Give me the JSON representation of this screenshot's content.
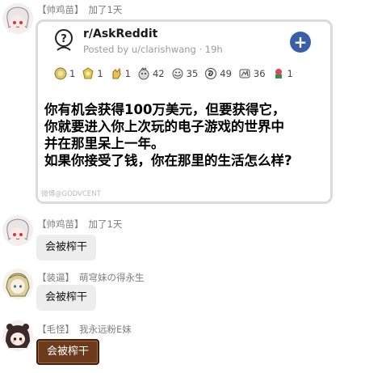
{
  "messages": [
    {
      "tag": "【帅鸡苗】",
      "nickname": "加了1天",
      "card": {
        "subreddit": "r/AskReddit",
        "posted_by": "Posted by u/clarishwang · 19h",
        "join_icon": "plus-icon",
        "awards": [
          {
            "icon": "silver-coin-award-icon",
            "count": "1"
          },
          {
            "icon": "gold-badge-award-icon",
            "count": "1"
          },
          {
            "icon": "clap-award-icon",
            "count": "1"
          },
          {
            "icon": "wholesome-award-icon",
            "count": "42"
          },
          {
            "icon": "hug-award-icon",
            "count": "35"
          },
          {
            "icon": "swirl-award-icon",
            "count": "49"
          },
          {
            "icon": "meme-award-icon",
            "count": "36"
          },
          {
            "icon": "flower-award-icon",
            "count": "1"
          }
        ],
        "text_lines": [
          "你有机会获得100万美元，但要获得它，",
          "你就要进入你上次玩的电子游戏的世界中",
          "并在那里呆上一年。",
          "如果你接受了钱，你在那里的生活怎么样?"
        ],
        "watermark": "微博@GODVCENT"
      }
    },
    {
      "tag": "【帅鸡苗】",
      "nickname": "加了1天",
      "text": "会被榨干"
    },
    {
      "tag": "【装逼】",
      "nickname": "萌穹妹の得永生",
      "text": "会被榨干"
    },
    {
      "tag": "【毛怪】",
      "nickname": "我永远粉E妹",
      "text": "会被榨干"
    }
  ],
  "colors": {
    "bubble_gray": "#ededed",
    "bubble_brown": "#6b3b1c",
    "join_blue": "#3a5ea8",
    "meta_gray": "#8a8a8a"
  }
}
